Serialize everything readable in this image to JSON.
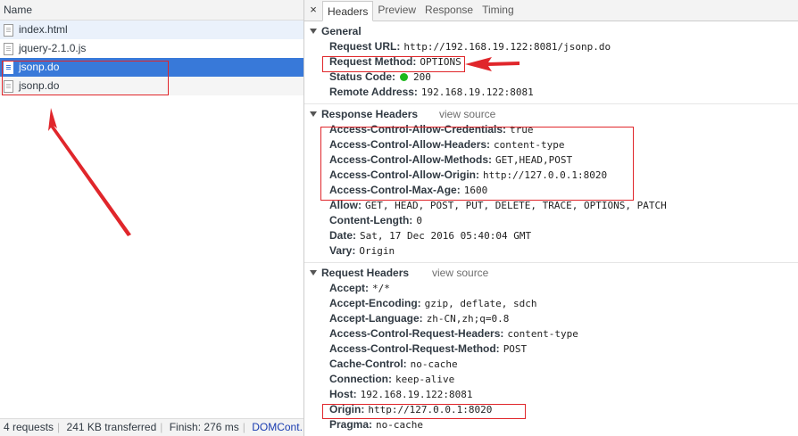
{
  "left_panel": {
    "column_header": "Name",
    "requests": [
      {
        "name": "index.html"
      },
      {
        "name": "jquery-2.1.0.js"
      },
      {
        "name": "jsonp.do"
      },
      {
        "name": "jsonp.do"
      }
    ],
    "status": {
      "requests": "4 requests",
      "transferred": "241 KB transferred",
      "finish": "Finish: 276 ms",
      "dom": "DOMCont..."
    }
  },
  "detail": {
    "close_glyph": "×",
    "tabs": [
      "Headers",
      "Preview",
      "Response",
      "Timing"
    ],
    "general": {
      "title": "General",
      "request_url_key": "Request URL:",
      "request_url_val": "http://192.168.19.122:8081/jsonp.do",
      "request_method_key": "Request Method:",
      "request_method_val": "OPTIONS",
      "status_code_key": "Status Code:",
      "status_code_val": "200",
      "remote_address_key": "Remote Address:",
      "remote_address_val": "192.168.19.122:8081"
    },
    "response_headers": {
      "title": "Response Headers",
      "view_source": "view source",
      "rows": [
        {
          "k": "Access-Control-Allow-Credentials:",
          "v": "true"
        },
        {
          "k": "Access-Control-Allow-Headers:",
          "v": "content-type"
        },
        {
          "k": "Access-Control-Allow-Methods:",
          "v": "GET,HEAD,POST"
        },
        {
          "k": "Access-Control-Allow-Origin:",
          "v": "http://127.0.0.1:8020"
        },
        {
          "k": "Access-Control-Max-Age:",
          "v": "1600"
        },
        {
          "k": "Allow:",
          "v": "GET, HEAD, POST, PUT, DELETE, TRACE, OPTIONS, PATCH"
        },
        {
          "k": "Content-Length:",
          "v": "0"
        },
        {
          "k": "Date:",
          "v": "Sat, 17 Dec 2016 05:40:04 GMT"
        },
        {
          "k": "Vary:",
          "v": "Origin"
        }
      ]
    },
    "request_headers": {
      "title": "Request Headers",
      "view_source": "view source",
      "rows": [
        {
          "k": "Accept:",
          "v": "*/*"
        },
        {
          "k": "Accept-Encoding:",
          "v": "gzip, deflate, sdch"
        },
        {
          "k": "Accept-Language:",
          "v": "zh-CN,zh;q=0.8"
        },
        {
          "k": "Access-Control-Request-Headers:",
          "v": "content-type"
        },
        {
          "k": "Access-Control-Request-Method:",
          "v": "POST"
        },
        {
          "k": "Cache-Control:",
          "v": "no-cache"
        },
        {
          "k": "Connection:",
          "v": "keep-alive"
        },
        {
          "k": "Host:",
          "v": "192.168.19.122:8081"
        },
        {
          "k": "Origin:",
          "v": "http://127.0.0.1:8020"
        },
        {
          "k": "Pragma:",
          "v": "no-cache"
        }
      ]
    }
  },
  "colors": {
    "selected_row": "#3879d9",
    "annotation_red": "#e0262b",
    "status_ok": "#1db91d"
  }
}
